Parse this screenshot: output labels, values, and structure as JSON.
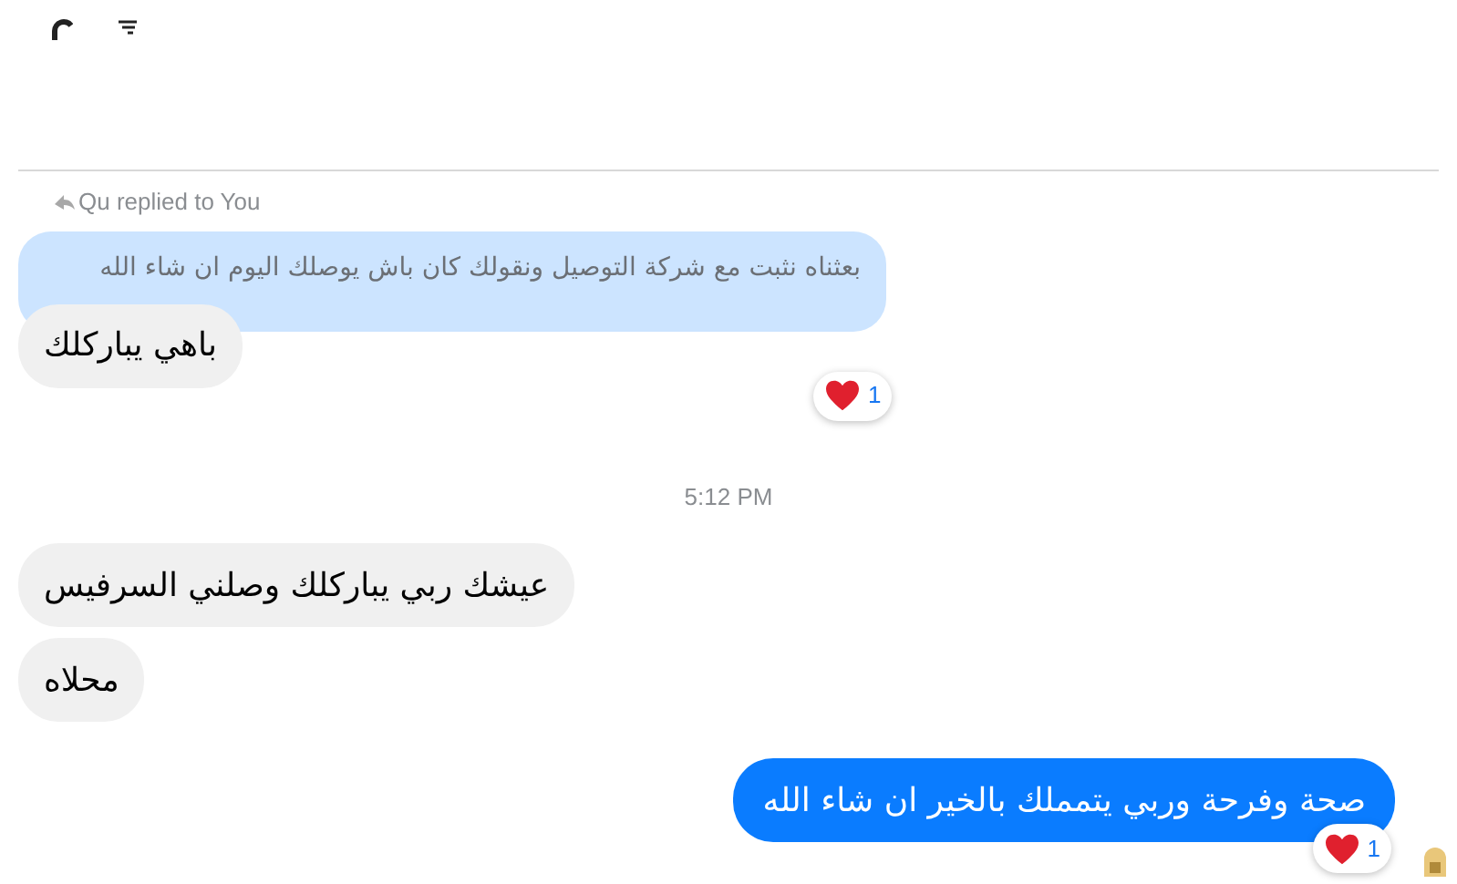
{
  "reply": {
    "label": "Qu replied to You",
    "quoted": "بعثناه نثبت مع شركة التوصيل ونقولك كان باش يوصلك اليوم ان شاء الله"
  },
  "messages": [
    {
      "kind": "incoming",
      "text": "باهي يباركلك",
      "reaction": {
        "count": "1"
      }
    },
    {
      "kind": "timestamp",
      "text": "5:12 PM"
    },
    {
      "kind": "incoming",
      "text": "عيشك ربي يباركلك وصلني السرفيس"
    },
    {
      "kind": "incoming",
      "text": "محلاه"
    },
    {
      "kind": "outgoing",
      "text": "صحة وفرحة  وربي يتمملك بالخير ان شاء الله",
      "reaction": {
        "count": "1"
      }
    }
  ]
}
